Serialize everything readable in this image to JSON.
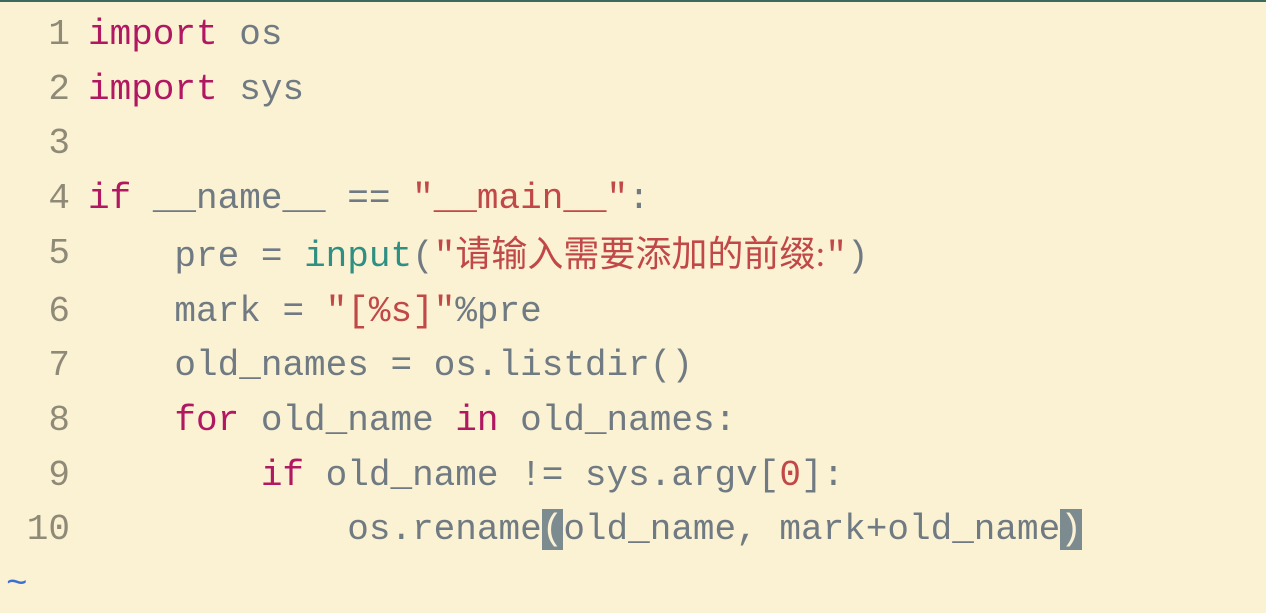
{
  "lines": [
    {
      "num": "1"
    },
    {
      "num": "2"
    },
    {
      "num": "3"
    },
    {
      "num": "4"
    },
    {
      "num": "5"
    },
    {
      "num": "6"
    },
    {
      "num": "7"
    },
    {
      "num": "8"
    },
    {
      "num": "9"
    },
    {
      "num": "10"
    }
  ],
  "tokens": {
    "import": "import",
    "os": "os",
    "sys": "sys",
    "if": "if",
    "name_dunder": "__name__",
    "eq": "==",
    "main_str_open": "\"",
    "main_str_body": "__main__",
    "main_str_close": "\"",
    "colon": ":",
    "pre": "pre",
    "assign": "=",
    "input": "input",
    "lparen": "(",
    "rparen": ")",
    "prompt_open": "\"",
    "prompt_cjk": "请输入需要添加的前缀:",
    "prompt_close": "\"",
    "mark": "mark",
    "fmt_open": "\"",
    "fmt_body": "[%s]",
    "fmt_close": "\"",
    "pct": "%",
    "old_names": "old_names",
    "dot": ".",
    "listdir": "listdir",
    "for": "for",
    "old_name": "old_name",
    "in": "in",
    "neq": "!=",
    "argv": "argv",
    "lbracket": "[",
    "zero": "0",
    "rbracket": "]",
    "rename": "rename",
    "comma": ",",
    "plus": "+",
    "space": " ",
    "indent1": "    ",
    "indent2": "        ",
    "indent3": "            "
  },
  "tilde": "~"
}
